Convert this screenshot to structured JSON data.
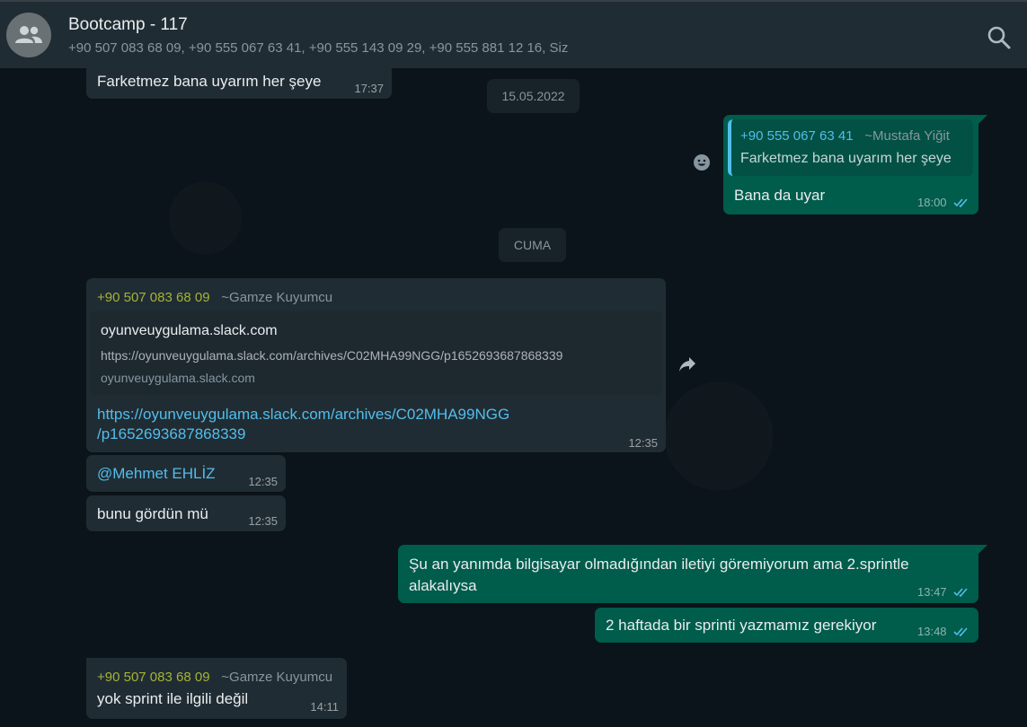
{
  "header": {
    "title": "Bootcamp - 117",
    "participants": "+90 507 083 68 09, +90 555 067 63 41, +90 555 143 09 29, +90 555 881 12 16, Siz"
  },
  "messages": {
    "m1": {
      "text": "Farketmez bana uyarım her şeye",
      "time": "17:37"
    },
    "date1": "15.05.2022",
    "m2": {
      "quote_phone": "+90 555 067 63 41",
      "quote_name": "~Mustafa Yiğit",
      "quote_text": "Farketmez bana uyarım her şeye",
      "text": "Bana da uyar",
      "time": "18:00"
    },
    "date2": "CUMA",
    "m3": {
      "sender_phone": "+90 507 083 68 09",
      "sender_name": "~Gamze Kuyumcu",
      "preview_title": "oyunveuygulama.slack.com",
      "preview_url": "https://oyunveuygulama.slack.com/archives/C02MHA99NGG/p1652693687868339",
      "preview_domain": "oyunveuygulama.slack.com",
      "link_line1": "https://oyunveuygulama.slack.com/archives/C02MHA99NGG",
      "link_line2": "/p1652693687868339",
      "time": "12:35"
    },
    "m4": {
      "text": "@Mehmet EHLİZ",
      "time": "12:35"
    },
    "m5": {
      "text": "bunu gördün mü",
      "time": "12:35"
    },
    "m6": {
      "line1": "Şu an yanımda bilgisayar olmadığından iletiyi göremiyorum ama 2.sprintle",
      "line2": "alakalıysa",
      "time": "13:47"
    },
    "m7": {
      "text": "2 haftada bir sprinti yazmamız gerekiyor",
      "time": "13:48"
    },
    "m8": {
      "sender_phone": "+90 507 083 68 09",
      "sender_name": "~Gamze Kuyumcu",
      "text": "yok sprint ile ilgili değil",
      "time": "14:11"
    }
  },
  "colors": {
    "background": "#0b141a",
    "header": "#202c33",
    "incoming": "#202c33",
    "outgoing": "#005c4b",
    "link": "#53bdeb",
    "read_ticks": "#53bdeb",
    "sender_phone": "#a5b337"
  },
  "icons": {
    "avatar": "group-icon",
    "search": "search-icon",
    "emoji": "emoji-icon",
    "forward": "forward-icon",
    "ticks": "double-check-icon"
  }
}
